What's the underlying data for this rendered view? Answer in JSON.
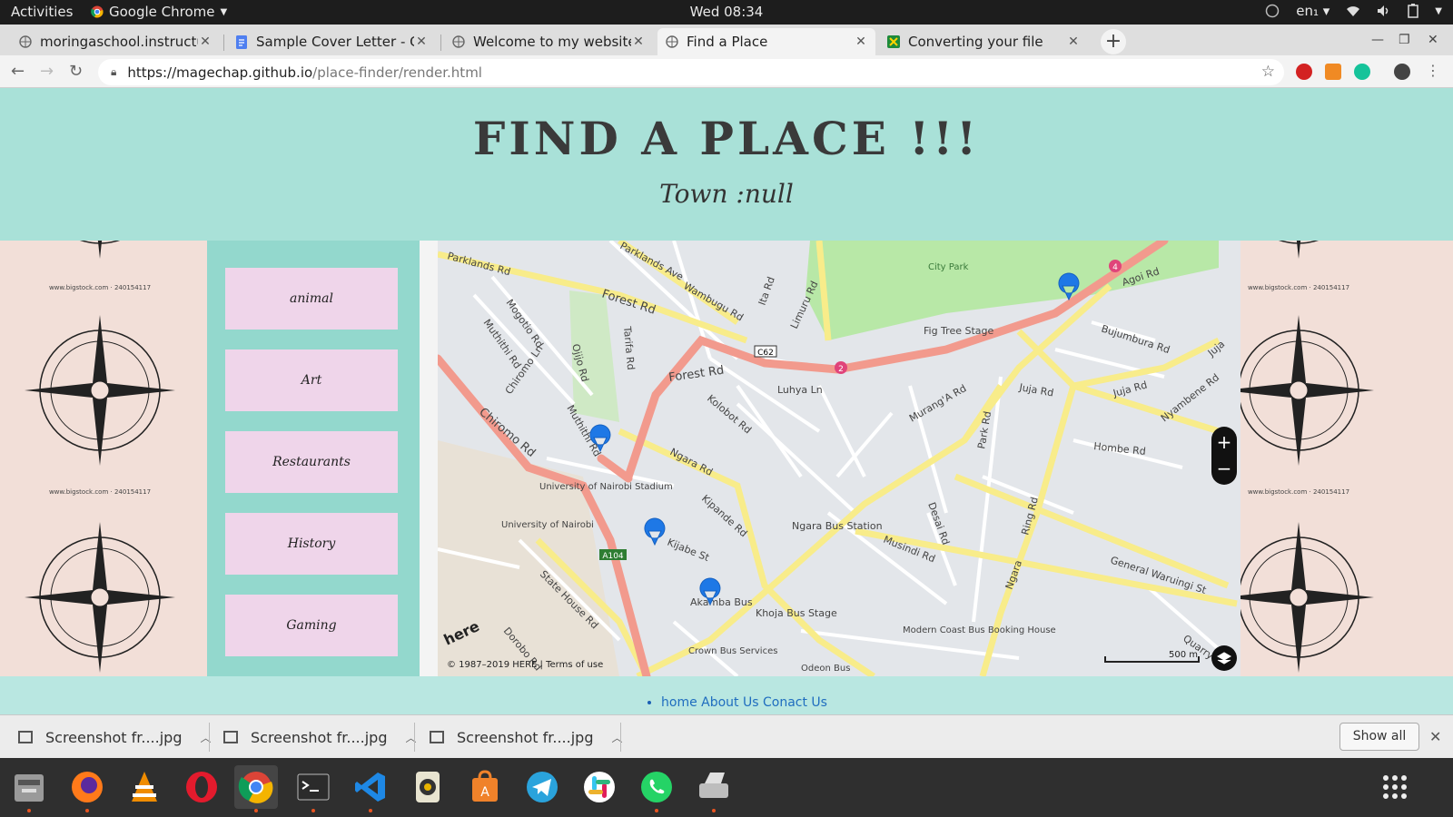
{
  "topbar": {
    "activities": "Activities",
    "app_name": "Google Chrome",
    "clock": "Wed 08:34",
    "lang": "en₁"
  },
  "tabs": [
    {
      "label": "moringaschool.instructur",
      "icon": "globe-icon"
    },
    {
      "label": "Sample Cover Letter - Goo",
      "icon": "docs-icon"
    },
    {
      "label": "Welcome to my website",
      "icon": "globe-icon"
    },
    {
      "label": "Find a Place",
      "icon": "globe-icon",
      "active": true
    },
    {
      "label": "Converting your file",
      "icon": "convert-icon"
    }
  ],
  "address": {
    "host": "https://magechap.github.io",
    "path": "/place-finder/render.html"
  },
  "page": {
    "title": "FIND A PLACE !!!",
    "subtitle": "Town :null",
    "categories": [
      "animal",
      "Art",
      "Restaurants",
      "History",
      "Gaming"
    ],
    "deco_watermark": "www.bigstock.com · 240154117",
    "footer_links": [
      "home",
      "About Us",
      "Conact Us"
    ]
  },
  "map": {
    "roads": [
      "Parklands Rd",
      "Parklands Ave",
      "Wambugu Rd",
      "Ita Rd",
      "Limuru Rd",
      "Agoi Rd",
      "Mogotio Rd",
      "Muthithi Rd",
      "Chiromo Ln",
      "Ojijo Rd",
      "Tarifa Rd",
      "Forest Rd",
      "Forest Rd",
      "Fig Tree Stage",
      "Bujumbura Rd",
      "Juja",
      "Juja Rd",
      "Juja Rd",
      "Luhya Ln",
      "Murang'A Rd",
      "Nyambene Rd",
      "Chiromo Rd",
      "Muthithi Rd",
      "Kolobot Rd",
      "Ngara Rd",
      "Park Rd",
      "Hombe Rd",
      "Kipande Rd",
      "Kijabe St",
      "Ngara Bus Station",
      "Desai Rd",
      "Ring Rd",
      "Musindi Rd",
      "General Waruingi St",
      "State House Rd",
      "Dorobo Rd",
      "Akamba Bus",
      "Khoja Bus Stage",
      "Modern Coast Bus Booking House",
      "Crown Bus Services",
      "Odeon Bus",
      "Quarry Rd",
      "Ngara",
      "City Park",
      "University of Nairobi Stadium",
      "University of Nairobi",
      "C62",
      "A104",
      "2",
      "4"
    ],
    "copyright": "© 1987–2019 HERE | Terms of use",
    "logo": "here",
    "scale": "500 m",
    "zoom_in": "+",
    "zoom_out": "−"
  },
  "downloads": {
    "items": [
      "Screenshot fr....jpg",
      "Screenshot fr....jpg",
      "Screenshot fr....jpg"
    ],
    "show_all": "Show all"
  },
  "dock": [
    "files-icon",
    "firefox-icon",
    "vlc-icon",
    "opera-icon",
    "chrome-icon",
    "terminal-icon",
    "vscode-icon",
    "rhythmbox-icon",
    "software-center-icon",
    "telegram-icon",
    "slack-icon",
    "whatsapp-icon",
    "scanner-icon",
    "app-grid-icon"
  ]
}
